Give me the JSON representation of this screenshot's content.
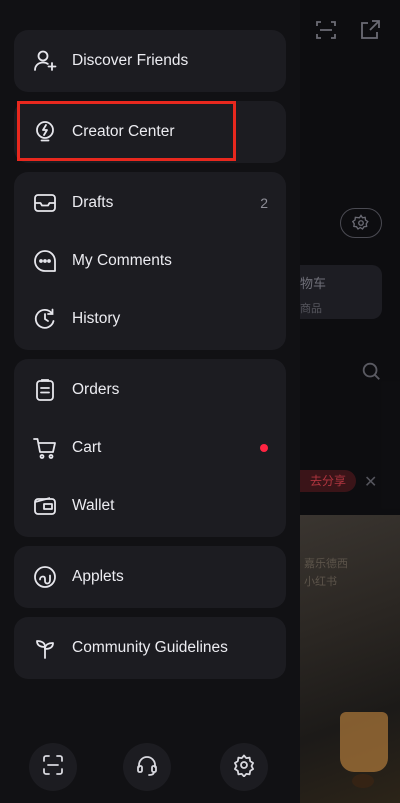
{
  "menu": {
    "discover_friends": "Discover Friends",
    "creator_center": "Creator Center",
    "drafts": "Drafts",
    "drafts_count": "2",
    "my_comments": "My Comments",
    "history": "History",
    "orders": "Orders",
    "cart": "Cart",
    "wallet": "Wallet",
    "applets": "Applets",
    "community_guidelines": "Community Guidelines"
  },
  "bottom_bar": {
    "icons": [
      "scan-icon",
      "customer-service-icon",
      "settings-icon"
    ]
  },
  "background": {
    "card_title": "物车",
    "card_subtitle": "商品",
    "share_label": "去分享",
    "photo_text": [
      "嘉乐德西",
      "小红书"
    ]
  },
  "colors": {
    "accent_red": "#ff2442",
    "highlight_box": "#e8281e",
    "card_bg": "#1c1c21",
    "drawer_bg": "#111114"
  }
}
